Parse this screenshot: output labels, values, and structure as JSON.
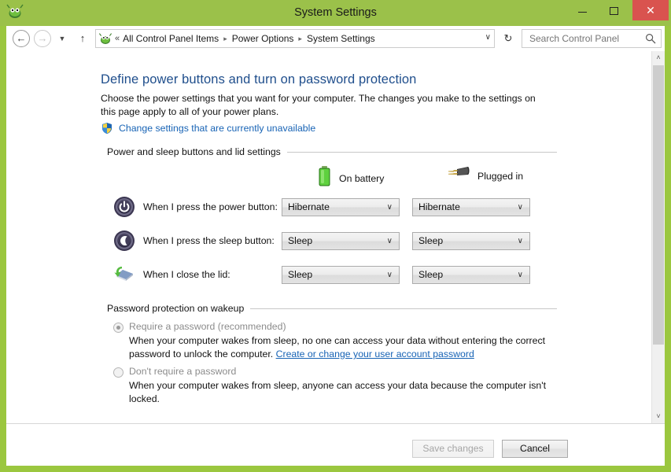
{
  "window": {
    "title": "System Settings",
    "app_icon": "control-panel-icon",
    "controls": {
      "minimize": "–",
      "maximize": "□",
      "close": "✕"
    }
  },
  "nav": {
    "back": "←",
    "forward": "→",
    "recent": "▼",
    "up": "↑",
    "refresh": "↻",
    "crumb_first_chevron": "«",
    "crumb_separator": "▸",
    "crumb_dropdown": "∨",
    "breadcrumbs": [
      "All Control Panel Items",
      "Power Options",
      "System Settings"
    ]
  },
  "search": {
    "placeholder": "Search Control Panel",
    "icon": "search-icon"
  },
  "page": {
    "title": "Define power buttons and turn on password protection",
    "description": "Choose the power settings that you want for your computer. The changes you make to the settings on this page apply to all of your power plans.",
    "uac_link": "Change settings that are currently unavailable"
  },
  "power_section": {
    "header": "Power and sleep buttons and lid settings",
    "columns": [
      {
        "label": "On battery",
        "icon": "battery-icon"
      },
      {
        "label": "Plugged in",
        "icon": "power-plug-icon"
      }
    ],
    "rows": [
      {
        "icon": "power-button-icon",
        "label": "When I press the power button:",
        "battery_value": "Hibernate",
        "plugged_value": "Hibernate"
      },
      {
        "icon": "sleep-moon-icon",
        "label": "When I press the sleep button:",
        "battery_value": "Sleep",
        "plugged_value": "Sleep"
      },
      {
        "icon": "laptop-lid-icon",
        "label": "When I close the lid:",
        "battery_value": "Sleep",
        "plugged_value": "Sleep"
      }
    ],
    "dropdown_arrow": "∨"
  },
  "password_section": {
    "header": "Password protection on wakeup",
    "options": [
      {
        "label": "Require a password (recommended)",
        "selected": true,
        "description_before": "When your computer wakes from sleep, no one can access your data without entering the correct password to unlock the computer. ",
        "link": "Create or change your user account password",
        "description_after": ""
      },
      {
        "label": "Don't require a password",
        "selected": false,
        "description_before": "When your computer wakes from sleep, anyone can access your data because the computer isn't locked.",
        "link": "",
        "description_after": ""
      }
    ]
  },
  "footer": {
    "save_label": "Save changes",
    "cancel_label": "Cancel"
  },
  "scrollbar": {
    "up_arrow": "˄",
    "down_arrow": "˅"
  },
  "colors": {
    "title_bar_green": "#9BC14A",
    "close_red": "#D9534F",
    "heading_blue": "#1F4E8C",
    "link_blue": "#1763B5",
    "battery_green": "#4CB53A"
  }
}
